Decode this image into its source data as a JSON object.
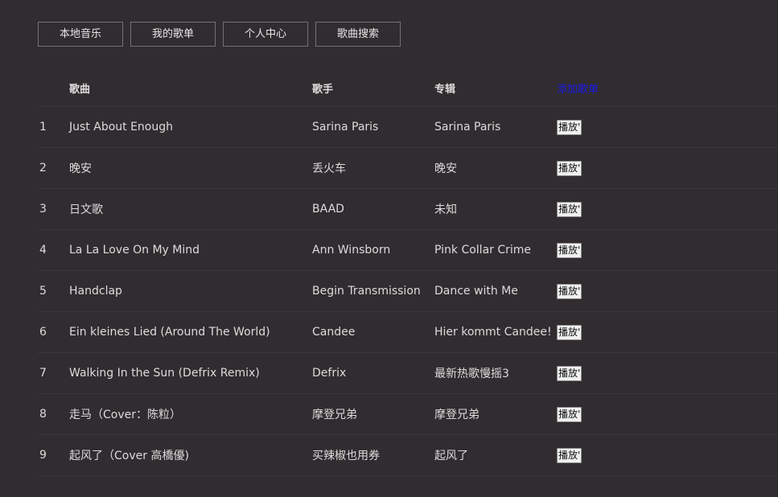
{
  "nav": [
    {
      "label": "本地音乐"
    },
    {
      "label": "我的歌单"
    },
    {
      "label": "个人中心"
    },
    {
      "label": "歌曲搜索"
    }
  ],
  "table": {
    "headers": {
      "song": "歌曲",
      "artist": "歌手",
      "album": "专辑",
      "action": "添加歌单"
    },
    "play_label": "播放'",
    "rows": [
      {
        "num": "1",
        "song": "Just About Enough",
        "artist": "Sarina Paris",
        "album": "Sarina Paris"
      },
      {
        "num": "2",
        "song": "晚安",
        "artist": "丢火车",
        "album": "晚安"
      },
      {
        "num": "3",
        "song": "日文歌",
        "artist": "BAAD",
        "album": "未知"
      },
      {
        "num": "4",
        "song": "La La Love On My Mind",
        "artist": "Ann Winsborn",
        "album": "Pink Collar Crime"
      },
      {
        "num": "5",
        "song": "Handclap",
        "artist": "Begin Transmission",
        "album": "Dance with Me"
      },
      {
        "num": "6",
        "song": "Ein kleines Lied (Around The World)",
        "artist": "Candee",
        "album": "Hier kommt Candee!"
      },
      {
        "num": "7",
        "song": "Walking In the Sun (Defrix Remix)",
        "artist": "Defrix",
        "album": "最新热歌慢摇3"
      },
      {
        "num": "8",
        "song": "走马（Cover：陈粒）",
        "artist": "摩登兄弟",
        "album": "摩登兄弟"
      },
      {
        "num": "9",
        "song": "起风了（Cover 高橋優)",
        "artist": "买辣椒也用券",
        "album": "起风了"
      }
    ]
  },
  "colors": {
    "background": "#312c30",
    "link": "#1a1af0"
  }
}
